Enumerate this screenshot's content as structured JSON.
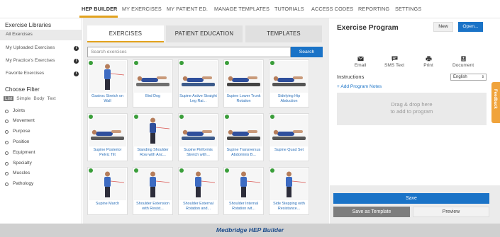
{
  "nav": {
    "items": [
      "HEP BUILDER",
      "MY EXERCISES",
      "MY PATIENT ED.",
      "MANAGE TEMPLATES",
      "TUTORIALS",
      "ACCESS CODES",
      "REPORTING",
      "SETTINGS"
    ],
    "active": "HEP BUILDER"
  },
  "sidebar": {
    "libraries_title": "Exercise Libraries",
    "libraries": [
      {
        "label": "All Exercises",
        "selected": true
      },
      {
        "label": "My Uploaded Exercises",
        "info_icon": "info-icon"
      },
      {
        "label": "My Practice's Exercises",
        "info_icon": "info-icon"
      },
      {
        "label": "Favorite Exercises",
        "info_icon": "info-icon"
      }
    ],
    "filter_title": "Choose Filter",
    "filter_tabs": [
      "List",
      "Simple",
      "Body",
      "Text"
    ],
    "filter_items": [
      "Joints",
      "Movement",
      "Purpose",
      "Position",
      "Equipment",
      "Specialty",
      "Muscles",
      "Pathology"
    ]
  },
  "center": {
    "tabs": [
      "EXERCISES",
      "PATIENT EDUCATION",
      "TEMPLATES"
    ],
    "search": {
      "placeholder": "Search exercises",
      "button": "Search"
    },
    "exercises": [
      {
        "name": "Gastroc Stretch on Wall",
        "icon": "exercise-thumbnail"
      },
      {
        "name": "Bird Dog",
        "icon": "exercise-thumbnail"
      },
      {
        "name": "Supine Active Straight Leg Rai...",
        "icon": "exercise-thumbnail"
      },
      {
        "name": "Supine Lower Trunk Rotation",
        "icon": "exercise-thumbnail"
      },
      {
        "name": "Sidelying Hip Abduction",
        "icon": "exercise-thumbnail"
      },
      {
        "name": "Supine Posterior Pelvic Tilt",
        "icon": "exercise-thumbnail"
      },
      {
        "name": "Standing Shoulder Row with Anc...",
        "icon": "exercise-thumbnail"
      },
      {
        "name": "Supine Piriformis Stretch with...",
        "icon": "exercise-thumbnail"
      },
      {
        "name": "Supine Transversus Abdominis B...",
        "icon": "exercise-thumbnail"
      },
      {
        "name": "Supine Quad Set",
        "icon": "exercise-thumbnail"
      },
      {
        "name": "Supine March",
        "icon": "exercise-thumbnail"
      },
      {
        "name": "Shoulder Extension with Resist...",
        "icon": "exercise-thumbnail"
      },
      {
        "name": "Shoulder External Rotation and...",
        "icon": "exercise-thumbnail"
      },
      {
        "name": "Shoulder Internal Rotation wit...",
        "icon": "exercise-thumbnail"
      },
      {
        "name": "Side Stepping with Resistance...",
        "icon": "exercise-thumbnail"
      }
    ]
  },
  "program": {
    "title": "Exercise Program",
    "new_label": "New",
    "open_label": "Open...",
    "actions": [
      {
        "label": "Email",
        "icon": "envelope-icon"
      },
      {
        "label": "SMS Text",
        "icon": "chat-icon"
      },
      {
        "label": "Print",
        "icon": "printer-icon"
      },
      {
        "label": "Document",
        "icon": "document-icon"
      }
    ],
    "instructions_label": "Instructions",
    "language": "English",
    "add_notes": "+ Add Program Notes",
    "dropzone": [
      "Drag & drop here",
      "to add to program"
    ],
    "save": "Save",
    "save_template": "Save as Template",
    "preview": "Preview",
    "feedback": "Feedback"
  },
  "footer": {
    "title": "Medbridge HEP Builder"
  },
  "colors": {
    "accent": "#e2a21d",
    "primary": "#1a73c7",
    "check": "#3a9e3a",
    "footer_text": "#1f4e8c"
  }
}
